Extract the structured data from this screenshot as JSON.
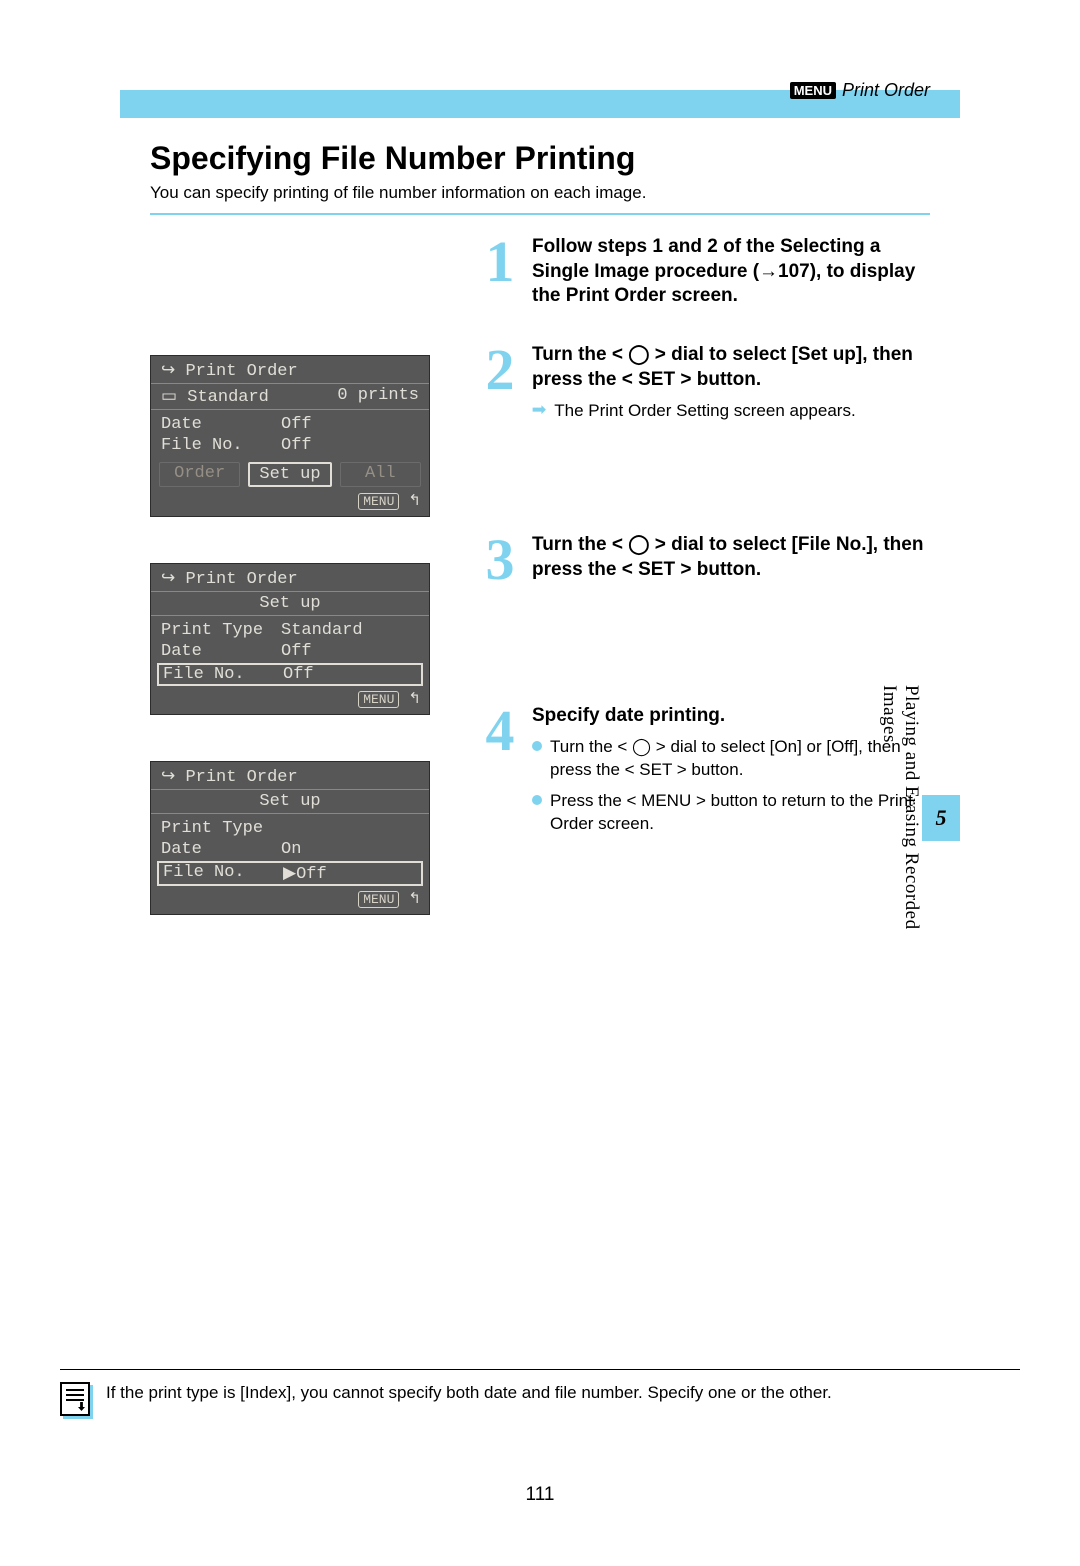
{
  "header": {
    "menu_label": "MENU",
    "section": "Print Order"
  },
  "title": "Specifying File Number Printing",
  "intro": "You can specify printing of file number information on each image.",
  "steps": [
    {
      "num": "1",
      "title_a": "Follow steps 1 and 2 of the Select­ing a  Single Image procedure",
      "title_b": "(→107), to display the Print Order screen."
    },
    {
      "num": "2",
      "title": "Turn the < ◯ > dial to select [Set up], then press the < SET > button.",
      "sub_arrow": "The Print Order Setting screen appears."
    },
    {
      "num": "3",
      "title": "Turn the < ◯ > dial to select [File No.], then press the < SET > button."
    },
    {
      "num": "4",
      "title": "Specify date printing.",
      "bullets": [
        "Turn the < ◯ > dial to select [On] or [Off], then press the < SET > button.",
        "Press the < MENU > button to return to the Print Order screen."
      ]
    }
  ],
  "lcd1": {
    "title": "Print Order",
    "sub_left": "Standard",
    "sub_right": "0 prints",
    "rows": [
      {
        "lbl": "Date",
        "val": "Off"
      },
      {
        "lbl": "File No.",
        "val": "Off"
      }
    ],
    "buttons": [
      "Order",
      "Set up",
      "All"
    ],
    "foot": "MENU"
  },
  "lcd2": {
    "title": "Print Order",
    "setup": "Set up",
    "rows": [
      {
        "lbl": "Print Type",
        "val": "Standard"
      },
      {
        "lbl": "Date",
        "val": "Off"
      },
      {
        "lbl": "File No.",
        "val": "Off",
        "selected": true
      }
    ],
    "foot": "MENU"
  },
  "lcd3": {
    "title": "Print Order",
    "setup": "Set up",
    "rows": [
      {
        "lbl": "Print Type",
        "val": ""
      },
      {
        "lbl": "Date",
        "val": "On"
      },
      {
        "lbl": "File No.",
        "val": "▶Off",
        "selected": true
      }
    ],
    "foot": "MENU"
  },
  "side": {
    "num": "5",
    "title": "Playing and Erasing Recorded Images"
  },
  "note": "If the print type is [Index], you cannot specify both date and file number. Specify one or the other.",
  "page_number": "111",
  "icons": {
    "menu_bold": "MENU"
  }
}
